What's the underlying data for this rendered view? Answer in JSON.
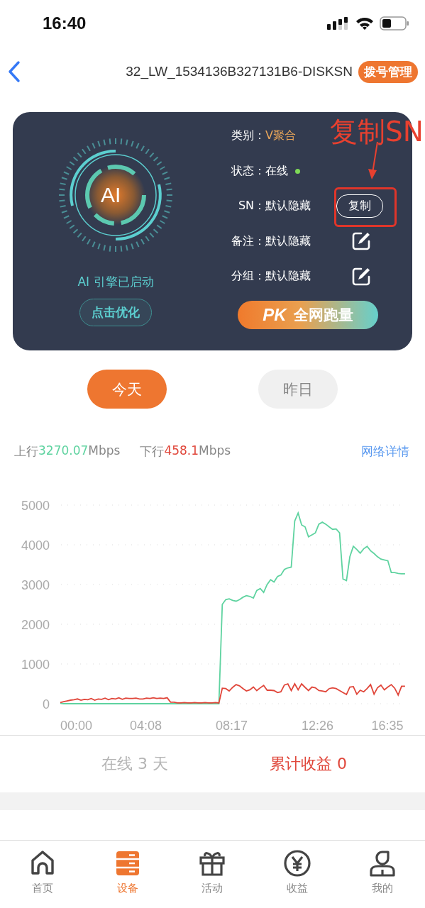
{
  "status_bar": {
    "time": "16:40"
  },
  "nav": {
    "title": "32_LW_1534136B327131B6-DISKSN",
    "badge": "拨号管理"
  },
  "card": {
    "engine": {
      "symbol": "AI",
      "status": "AI 引擎已启动",
      "button": "点击优化"
    },
    "rows": [
      {
        "kind": "category",
        "label": "类别：",
        "value": "V聚合"
      },
      {
        "kind": "status",
        "label": "状态：",
        "value": "在线",
        "color": "#7ed957"
      },
      {
        "kind": "copy",
        "label": "SN：",
        "value": "默认隐藏",
        "action": "复制"
      },
      {
        "kind": "edit",
        "label": "备注：",
        "value": "默认隐藏"
      },
      {
        "kind": "edit",
        "label": "分组：",
        "value": "默认隐藏"
      }
    ],
    "pk_button": {
      "tag": "PK",
      "label": "全网跑量"
    },
    "annotation": {
      "text": "复制SN"
    }
  },
  "day_tabs": [
    {
      "label": "今天",
      "selected": true
    },
    {
      "label": "昨日",
      "selected": false
    }
  ],
  "speeds": [
    {
      "value": "3270.07",
      "unit": "Mbps",
      "color": "#5fd3a0"
    },
    {
      "value": "458.1",
      "unit": "Mbps",
      "color": "#e0463a"
    }
  ],
  "details_link": "网络详情",
  "chart": {
    "chart_data": {
      "type": "line",
      "grid": true,
      "xlim": [
        0,
        1000
      ],
      "ylim": [
        0,
        5000
      ],
      "yticks": [
        0,
        1000,
        2000,
        3000,
        4000,
        5000
      ],
      "xticks": [
        {
          "value": 0,
          "label": "00:00"
        },
        {
          "value": 248,
          "label": "04:08"
        },
        {
          "value": 497,
          "label": "08:17"
        },
        {
          "value": 746,
          "label": "12:26"
        },
        {
          "value": 995,
          "label": "16:35"
        }
      ],
      "x": [
        0,
        10,
        20,
        30,
        40,
        50,
        60,
        70,
        80,
        90,
        100,
        110,
        120,
        130,
        140,
        150,
        160,
        170,
        180,
        190,
        200,
        210,
        220,
        230,
        240,
        250,
        260,
        270,
        280,
        290,
        300,
        310,
        320,
        330,
        340,
        350,
        360,
        370,
        380,
        390,
        400,
        410,
        420,
        430,
        440,
        450,
        460,
        470,
        480,
        490,
        500,
        510,
        520,
        530,
        540,
        550,
        560,
        570,
        580,
        590,
        600,
        610,
        620,
        630,
        640,
        650,
        660,
        670,
        680,
        690,
        700,
        710,
        720,
        730,
        740,
        750,
        760,
        770,
        780,
        790,
        800,
        810,
        820,
        830,
        840,
        850,
        860,
        870,
        880,
        890,
        900,
        910,
        920,
        930,
        940,
        950,
        960,
        970,
        980,
        990,
        1000
      ],
      "series": [
        {
          "name": "上行",
          "color": "#5fd3a0",
          "values": [
            10,
            0,
            0,
            0,
            0,
            0,
            0,
            0,
            0,
            0,
            0,
            0,
            0,
            0,
            0,
            0,
            0,
            0,
            0,
            0,
            0,
            0,
            0,
            0,
            0,
            0,
            0,
            0,
            0,
            0,
            0,
            0,
            0,
            0,
            0,
            0,
            0,
            0,
            0,
            0,
            0,
            0,
            0,
            0,
            0,
            0,
            0,
            2500,
            2620,
            2640,
            2600,
            2580,
            2620,
            2680,
            2720,
            2700,
            2660,
            2850,
            2900,
            2800,
            3000,
            3120,
            3060,
            3200,
            3240,
            3380,
            3420,
            3440,
            4600,
            4800,
            4500,
            4450,
            4200,
            4250,
            4300,
            4520,
            4570,
            4520,
            4450,
            4390,
            4400,
            4300,
            3140,
            3100,
            3700,
            3960,
            3880,
            3790,
            3900,
            3960,
            3850,
            3780,
            3700,
            3640,
            3620,
            3600,
            3300,
            3300,
            3280,
            3270,
            3270
          ]
        },
        {
          "name": "下行",
          "color": "#e0463a",
          "values": [
            30,
            50,
            70,
            90,
            100,
            120,
            90,
            110,
            100,
            130,
            90,
            120,
            110,
            140,
            100,
            130,
            120,
            150,
            110,
            140,
            130,
            130,
            140,
            120,
            120,
            140,
            130,
            150,
            130,
            140,
            130,
            150,
            40,
            40,
            20,
            20,
            30,
            20,
            20,
            30,
            20,
            20,
            30,
            20,
            20,
            30,
            20,
            390,
            380,
            320,
            410,
            480,
            450,
            380,
            320,
            350,
            420,
            330,
            400,
            460,
            340,
            340,
            330,
            280,
            300,
            470,
            500,
            330,
            500,
            350,
            500,
            410,
            330,
            420,
            400,
            330,
            320,
            300,
            380,
            400,
            380,
            330,
            280,
            230,
            420,
            430,
            240,
            340,
            300,
            380,
            480,
            240,
            400,
            470,
            350,
            420,
            480,
            390,
            220,
            440,
            440
          ]
        }
      ]
    }
  },
  "stats": {
    "online": "在线 3 天",
    "earnings": "累计收益 0"
  },
  "tab_bar": [
    {
      "label": "首页",
      "selected": false
    },
    {
      "label": "设备",
      "selected": true
    },
    {
      "label": "活动",
      "selected": false
    },
    {
      "label": "收益",
      "selected": false
    },
    {
      "label": "我的",
      "selected": false
    }
  ]
}
